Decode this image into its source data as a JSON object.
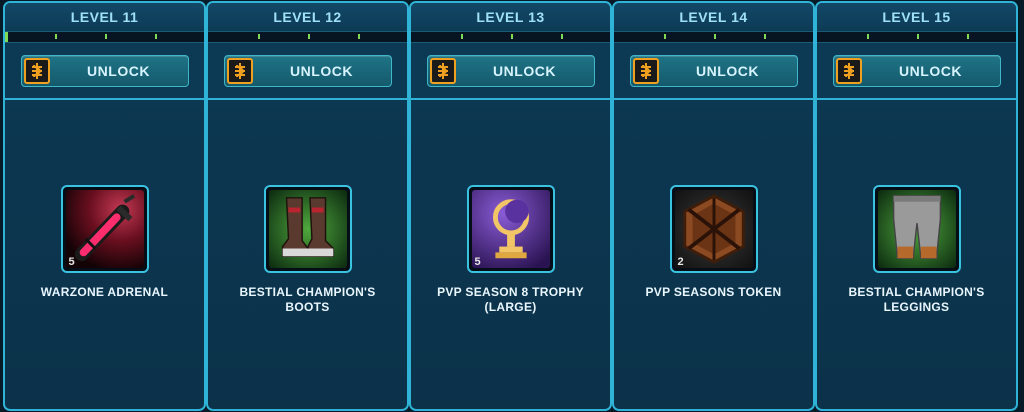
{
  "levels": [
    {
      "label": "LEVEL 11",
      "button": "UNLOCK",
      "reward": {
        "name": "WARZONE ADRENAL",
        "quantity": "5",
        "icon": "adrenal-icon"
      }
    },
    {
      "label": "LEVEL 12",
      "button": "UNLOCK",
      "reward": {
        "name": "BESTIAL CHAMPION'S BOOTS",
        "quantity": "",
        "icon": "boots-icon"
      }
    },
    {
      "label": "LEVEL 13",
      "button": "UNLOCK",
      "reward": {
        "name": "PVP SEASON 8 TROPHY (LARGE)",
        "quantity": "5",
        "icon": "trophy-icon"
      }
    },
    {
      "label": "LEVEL 14",
      "button": "UNLOCK",
      "reward": {
        "name": "PVP SEASONS TOKEN",
        "quantity": "2",
        "icon": "token-icon"
      }
    },
    {
      "label": "LEVEL 15",
      "button": "UNLOCK",
      "reward": {
        "name": "BESTIAL CHAMPION'S LEGGINGS",
        "quantity": "",
        "icon": "leggings-icon"
      }
    }
  ],
  "colors": {
    "accent": "#2fb3d6",
    "progress": "#7ed957",
    "unlock_icon_border": "#f0a020"
  }
}
